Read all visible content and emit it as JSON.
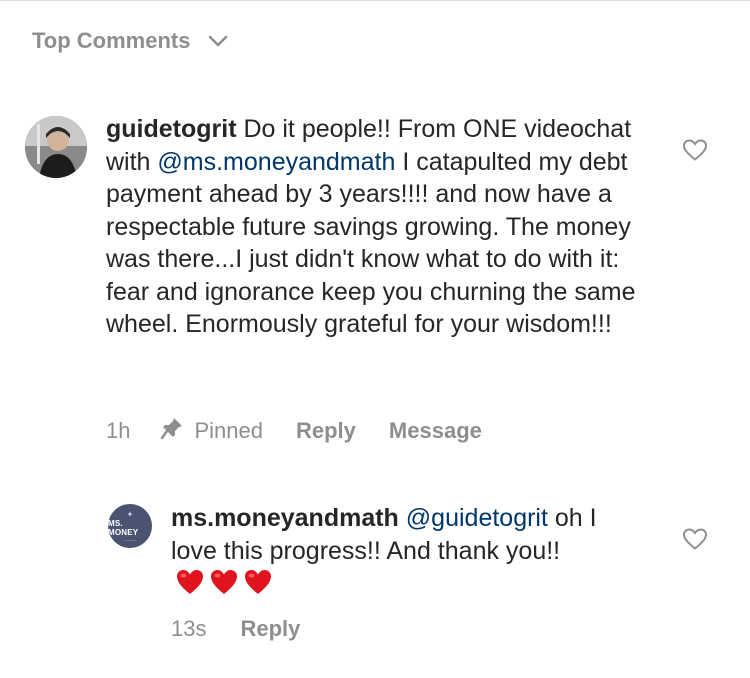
{
  "header": {
    "sort_label": "Top Comments",
    "sort_icon": "chevron-down-icon"
  },
  "comments": [
    {
      "username": "guidetogrit",
      "text_before": " Do it people!! From ONE videochat with ",
      "mention": "@ms.moneyandmath",
      "text_after": " I catapulted my debt payment ahead by 3 years!!!! and now have a respectable future savings growing. The money was there...I just didn't know what to do with it: fear and ignorance keep you churning the same wheel. Enormously grateful for your wisdom!!!",
      "time": "1h",
      "pinned_label": "Pinned",
      "reply_label": "Reply",
      "message_label": "Message",
      "like_icon": "heart-outline-icon"
    },
    {
      "username": "ms.moneyandmath",
      "mention": "@guidetogrit",
      "text": "oh I love this progress!! And thank you!!",
      "emoji": "❤️❤️❤️",
      "avatar_text": "MS. MONEY",
      "time": "13s",
      "reply_label": "Reply",
      "like_icon": "heart-outline-icon"
    }
  ],
  "colors": {
    "text": "#262626",
    "secondary": "#8e8e8e",
    "mention": "#00376b",
    "heart_emoji": "#e0141e",
    "avatar_bg": "#4a5470"
  }
}
